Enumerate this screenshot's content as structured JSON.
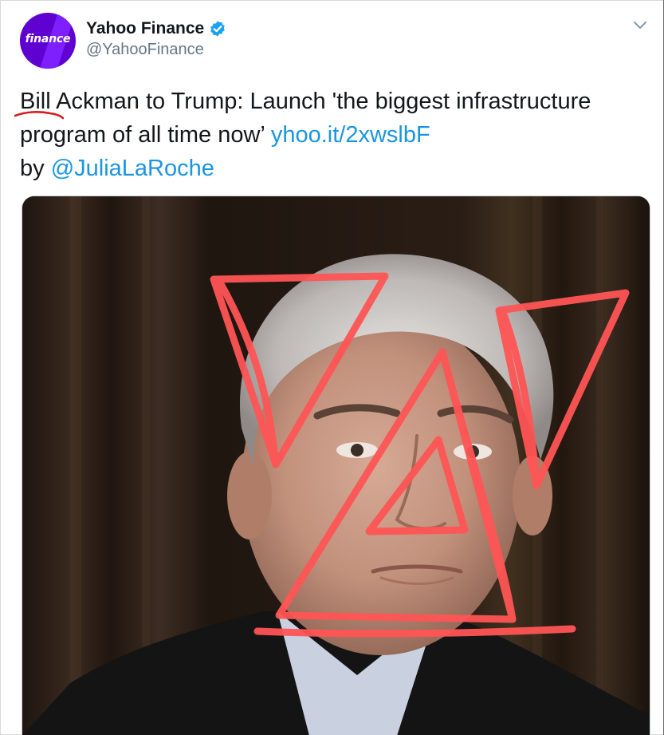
{
  "tweet": {
    "author": {
      "display_name": "Yahoo Finance",
      "handle": "@YahooFinance",
      "avatar_text": "finance",
      "verified": true
    },
    "text": {
      "part1": "Bill Ackman to Trump: Launch 'the biggest infrastructure program of all time now’ ",
      "link": "yhoo.it/2xwslbF",
      "part2": "by ",
      "mention": "@JuliaLaRoche"
    },
    "menu_icon": "chevron-down-icon",
    "media": {
      "type": "photo",
      "annotation": "hand-drawn red triangles over portrait"
    }
  },
  "colors": {
    "link": "#1b95e0",
    "verified_badge": "#1da1f2",
    "avatar_bg": "#5f01d1",
    "annotation_red": "#ff5555",
    "handle_gray": "#657786"
  }
}
